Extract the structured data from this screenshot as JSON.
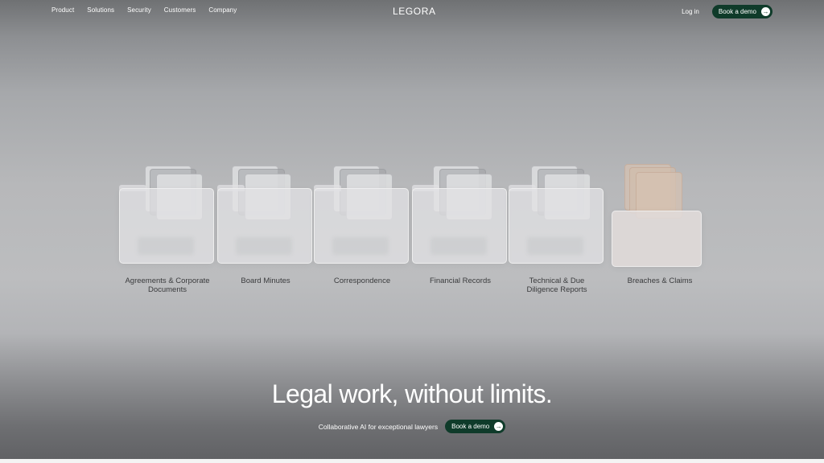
{
  "nav": {
    "links": [
      "Product",
      "Solutions",
      "Security",
      "Customers",
      "Company"
    ],
    "logo": "LEGORA",
    "login": "Log in",
    "demo_label": "Book a demo",
    "arrow_icon": "arrow-right-icon"
  },
  "folders": [
    {
      "label_1": "Agreements & Corporate",
      "label_2": "Documents"
    },
    {
      "label_1": "Board Minutes",
      "label_2": ""
    },
    {
      "label_1": "Correspondence",
      "label_2": ""
    },
    {
      "label_1": "Financial Records",
      "label_2": ""
    },
    {
      "label_1": "Technical & Due",
      "label_2": "Diligence Reports"
    },
    {
      "label_1": "Breaches & Claims",
      "label_2": ""
    }
  ],
  "hero": {
    "headline": "Legal work, without limits.",
    "subtext": "Collaborative AI for exceptional lawyers",
    "demo_label": "Book a demo"
  },
  "colors": {
    "button_bg": "#0f3b2a",
    "text_light": "#ffffff",
    "label_dark": "#3a3b3d"
  }
}
